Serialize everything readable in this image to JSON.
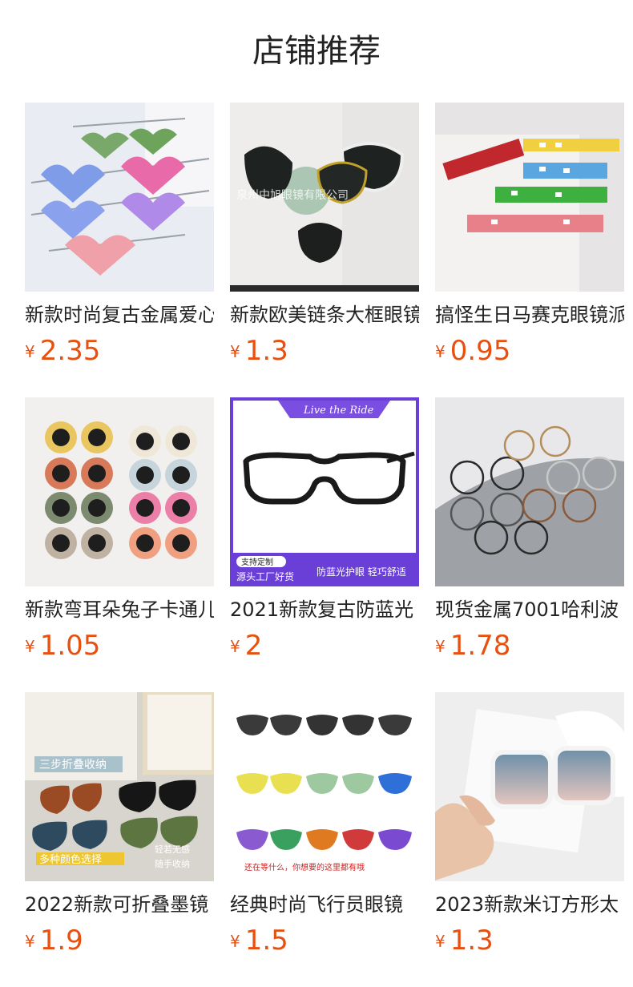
{
  "page": {
    "title": "店铺推荐"
  },
  "products": [
    {
      "title": "新款时尚复古金属爱心",
      "currency": "¥",
      "price": "2.35"
    },
    {
      "title": "新款欧美链条大框眼镜",
      "currency": "¥",
      "price": "1.3"
    },
    {
      "title": "搞怪生日马赛克眼镜派",
      "currency": "¥",
      "price": "0.95"
    },
    {
      "title": "新款弯耳朵兔子卡通儿",
      "currency": "¥",
      "price": "1.05"
    },
    {
      "title": "2021新款复古防蓝光",
      "currency": "¥",
      "price": "2"
    },
    {
      "title": "现货金属7001哈利波",
      "currency": "¥",
      "price": "1.78"
    },
    {
      "title": "2022新款可折叠墨镜",
      "currency": "¥",
      "price": "1.9"
    },
    {
      "title": "经典时尚飞行员眼镜",
      "currency": "¥",
      "price": "1.5"
    },
    {
      "title": "2023新款米订方形太",
      "currency": "¥",
      "price": "1.3"
    }
  ],
  "image_text": {
    "p2_watermark": "泉州中旭眼镜有限公司",
    "p5_banner": "Live the Ride",
    "p5_badge": "支持定制",
    "p5_source": "源头工厂好货",
    "p5_feature": "防蓝光护眼 轻巧舒适",
    "p7_top": "三步折叠收纳",
    "p7_bottom": "多种颜色选择",
    "p7_tag1": "轻若无感",
    "p7_tag2": "随手收纳",
    "p8_caption": "还在等什么，你想要的这里都有哦"
  }
}
